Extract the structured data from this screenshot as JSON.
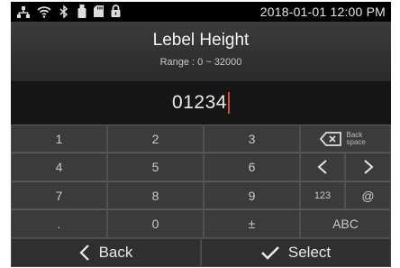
{
  "status": {
    "time": "2018-01-01 12:00 PM",
    "icons": [
      "network-icon",
      "wifi-icon",
      "bluetooth-icon",
      "usb-icon",
      "sd-card-icon",
      "lock-icon"
    ]
  },
  "header": {
    "title": "Lebel Height",
    "range": "Range : 0 ~ 32000"
  },
  "input": {
    "value": "01234"
  },
  "keypad": {
    "keys": {
      "k1": "1",
      "k2": "2",
      "k3": "3",
      "k4": "4",
      "k5": "5",
      "k6": "6",
      "k7": "7",
      "k8": "8",
      "k9": "9",
      "dot": ".",
      "k0": "0",
      "plusminus": "±",
      "numeric_mode": "123",
      "at": "@",
      "abc": "ABC",
      "backspace_line1": "Back",
      "backspace_line2": "space",
      "left": "<",
      "right": ">"
    }
  },
  "footer": {
    "back_label": "Back",
    "select_label": "Select"
  },
  "colors": {
    "background": "#0d0d0d",
    "key": "#3b3b3b",
    "caret": "#e0483a",
    "text": "#f5f5f5"
  }
}
